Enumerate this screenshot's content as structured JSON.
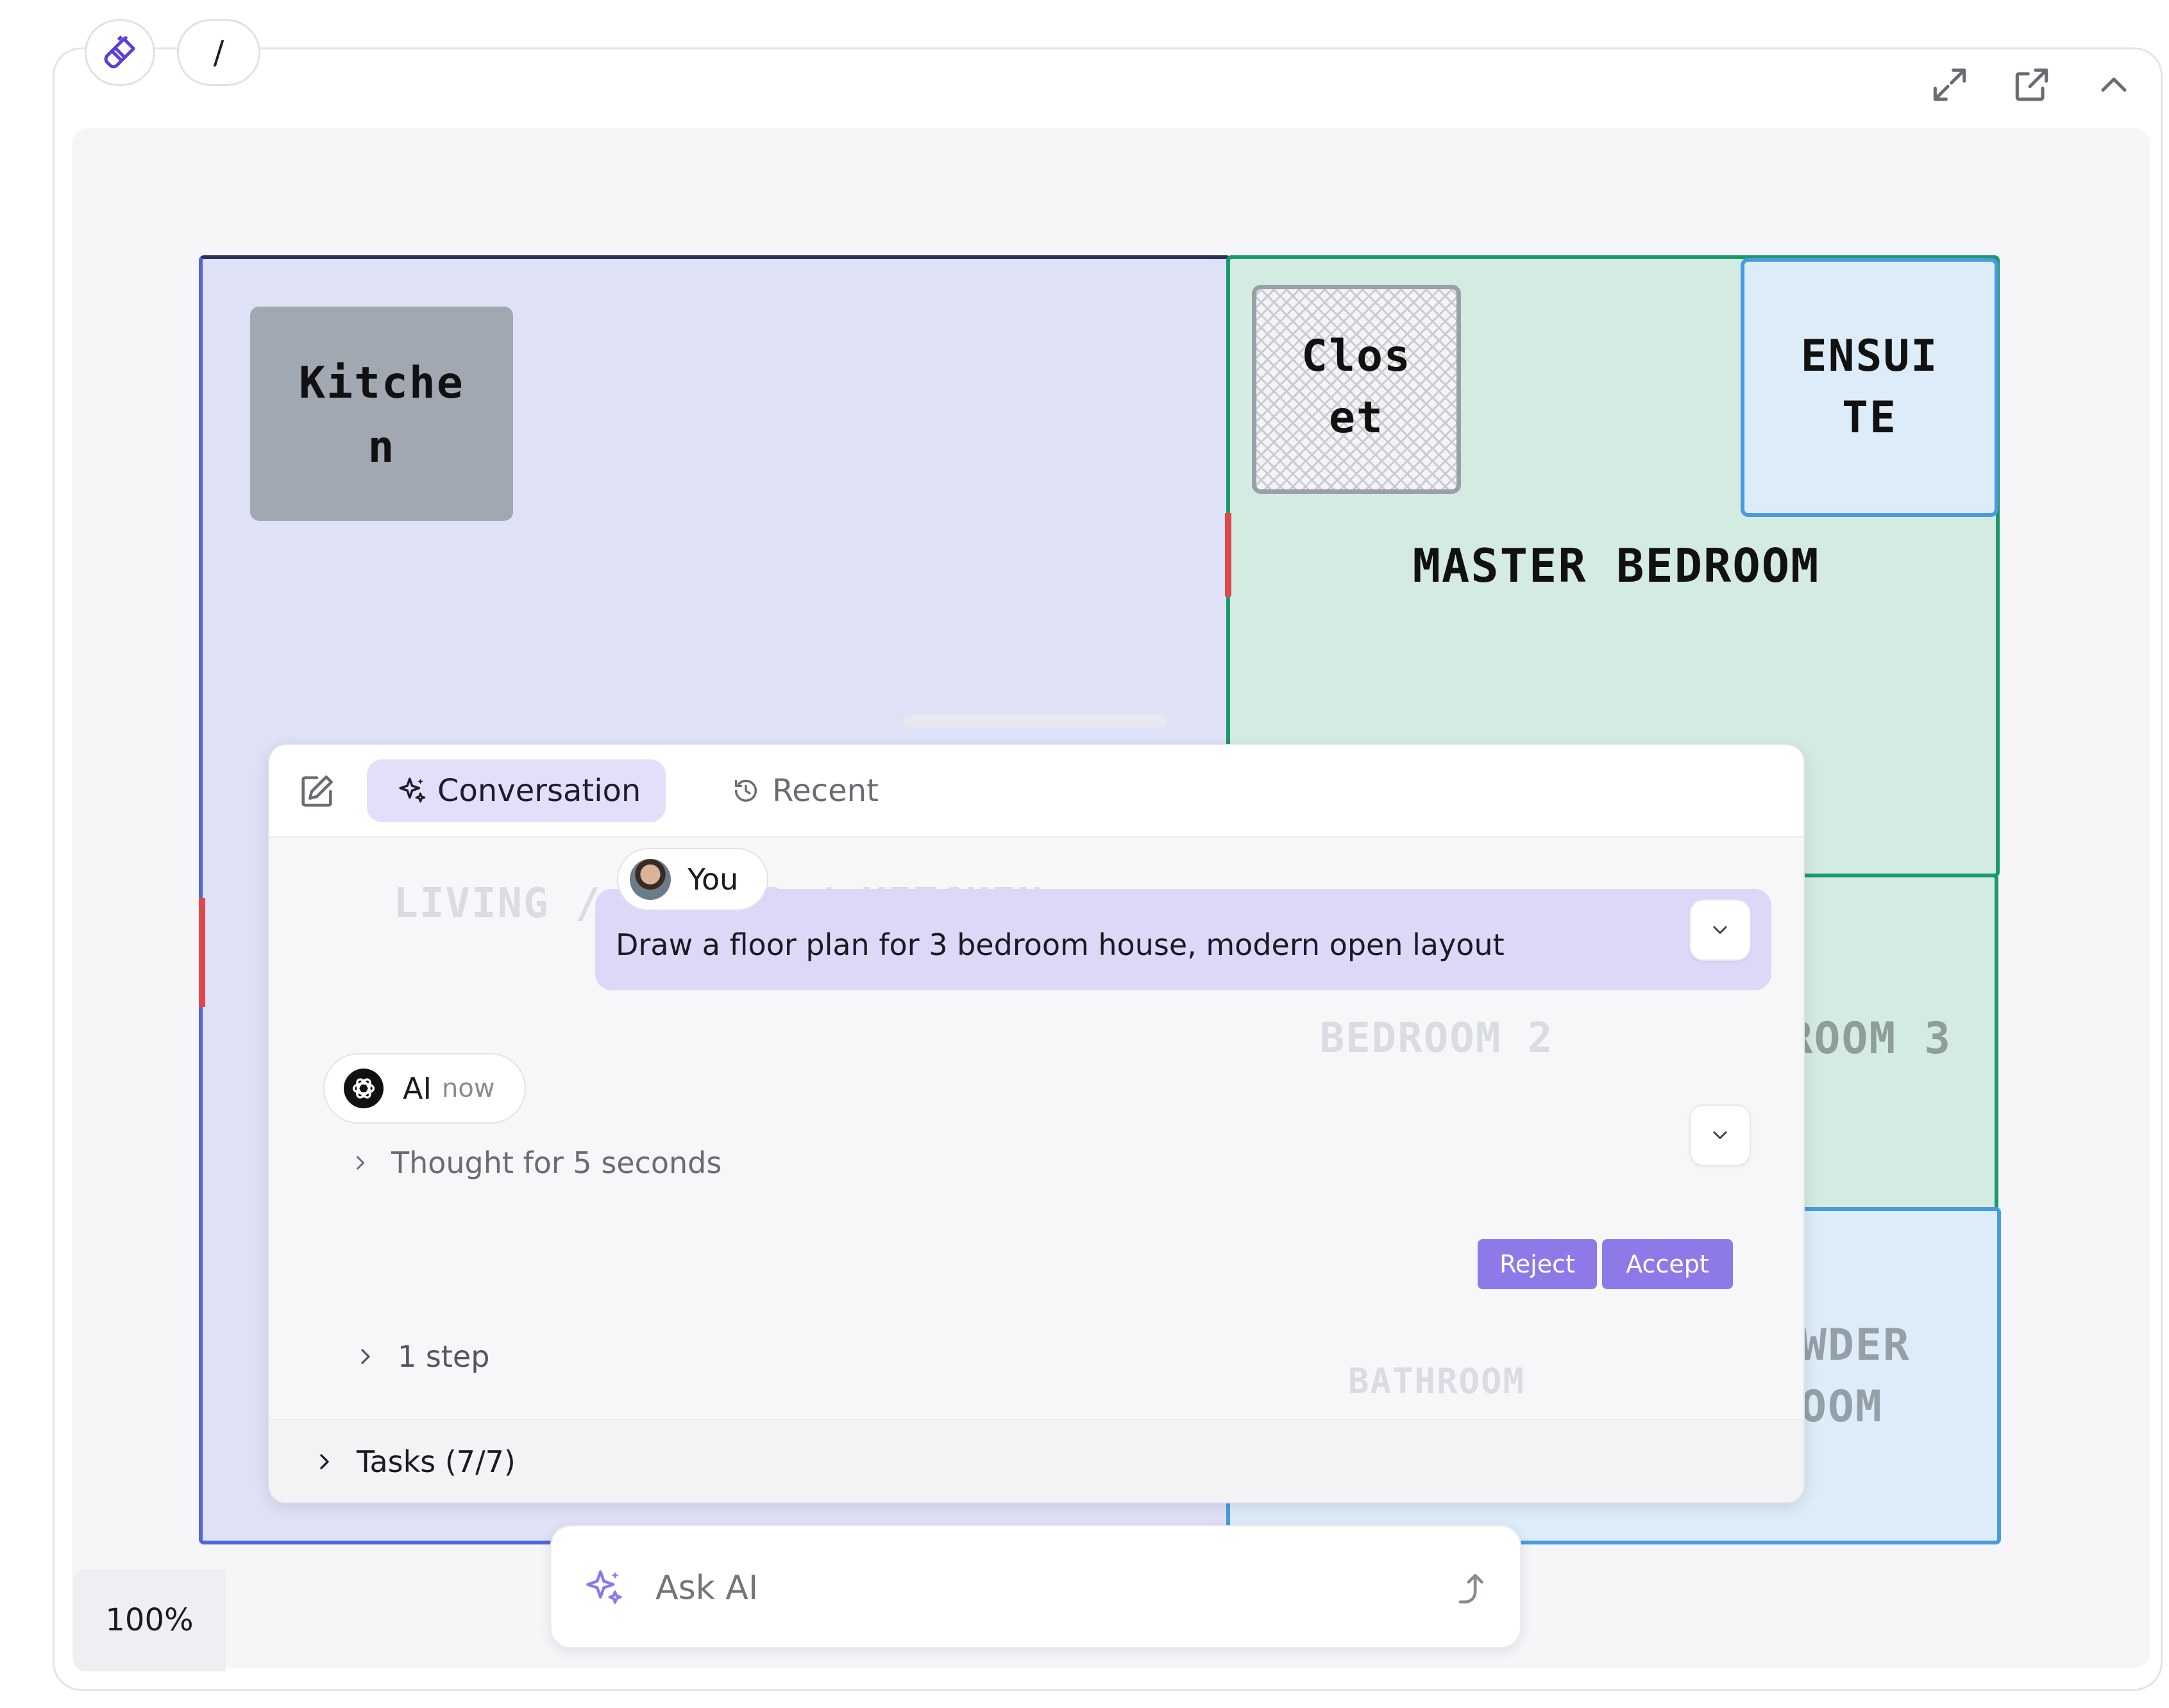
{
  "toolbar": {
    "slash_label": "/",
    "brush_icon": "paintbrush-icon",
    "expand_icon": "expand-icon",
    "open_external_icon": "external-link-icon",
    "collapse_icon": "chevron-up-icon"
  },
  "floorplan": {
    "rooms": {
      "kitchen": "Kitche\nn",
      "closet": "Clos\net",
      "ensuite": "ENSUI\nTE",
      "master_bedroom": "MASTER BEDROOM",
      "living": "LIVING / DINING / KITCHEN",
      "bedroom2": "BEDROOM 2",
      "bedroom3": "BEDROOM 3",
      "bathroom": "BATHROOM",
      "powder_room": "POWDER\nROOM"
    },
    "colors": {
      "living_fill": "#dfe2f6",
      "living_border": "#4f66d8",
      "master_fill": "#d4ebe2",
      "master_border": "#1a9a6a",
      "ensuite_fill": "#dcecf8",
      "ensuite_border": "#4a9ae0",
      "kitchen_fill": "#a2a8b2",
      "door_accent": "#e0474c"
    }
  },
  "chat": {
    "tabs": {
      "new_icon": "compose-icon",
      "conversation_label": "Conversation",
      "conversation_icon": "sparkles-icon",
      "recent_label": "Recent",
      "recent_icon": "history-icon"
    },
    "user": {
      "name": "You",
      "message": "Draw a floor plan for 3 bedroom house, modern open layout"
    },
    "ai": {
      "name": "AI",
      "time": "now",
      "thought": "Thought for 5 seconds",
      "step": "1 step"
    },
    "actions": {
      "reject": "Reject",
      "accept": "Accept"
    },
    "tasks_label": "Tasks (7/7)",
    "accent": "#8d7ae8"
  },
  "ask": {
    "placeholder": "Ask AI"
  },
  "zoom": {
    "level": "100%"
  }
}
